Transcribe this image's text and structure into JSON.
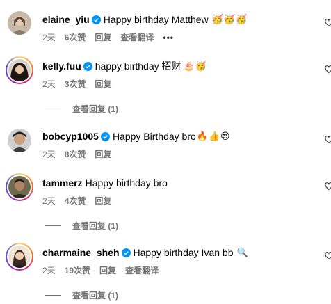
{
  "comments": [
    {
      "user": "elaine_yiu",
      "verified": true,
      "text": "Happy birthday Matthew",
      "emojis": [
        "🥳",
        "🥳",
        "🥳"
      ],
      "time": "2天",
      "likes": "6次赞",
      "reply": "回复",
      "translate": "查看翻译",
      "more": "•••",
      "replies": null,
      "story_ring": false
    },
    {
      "user": "kelly.fuu",
      "verified": true,
      "text": "happy birthday 招财",
      "emojis": [
        "🎂",
        "🥳"
      ],
      "time": "2天",
      "likes": "3次赞",
      "reply": "回复",
      "translate": null,
      "more": null,
      "replies": "查看回复 (1)",
      "story_ring": true
    },
    {
      "user": "bobcyp1005",
      "verified": true,
      "text": "Happy Birthday bro",
      "emojis": [
        "🔥",
        "👍",
        "😍"
      ],
      "time": "2天",
      "likes": "8次赞",
      "reply": "回复",
      "translate": null,
      "more": null,
      "replies": null,
      "story_ring": false
    },
    {
      "user": "tammerz",
      "verified": false,
      "text": "Happy birthday bro",
      "emojis": [],
      "time": "2天",
      "likes": "4次赞",
      "reply": "回复",
      "translate": null,
      "more": null,
      "replies": "查看回复 (1)",
      "story_ring": true
    },
    {
      "user": "charmaine_sheh",
      "verified": true,
      "text": "Happy birthday Ivan bb",
      "emojis": [
        "🔍"
      ],
      "time": "2天",
      "likes": "19次赞",
      "reply": "回复",
      "translate": "查看翻译",
      "more": null,
      "replies": "查看回复 (1)",
      "story_ring": true
    }
  ],
  "colors": {
    "verified": "#0095f6",
    "meta": "#737373"
  }
}
